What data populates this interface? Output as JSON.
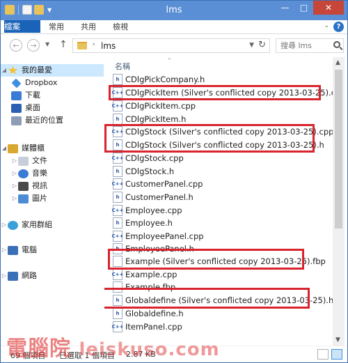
{
  "window": {
    "title": "lms"
  },
  "ribbon": {
    "tabs": [
      "檔案",
      "常用",
      "共用",
      "檢視"
    ],
    "help": "?"
  },
  "address": {
    "path": "lms"
  },
  "search": {
    "placeholder": "搜尋 lms"
  },
  "navpane": {
    "items": [
      {
        "label": "我的最愛",
        "icon": "star-icon",
        "color": "#f2c230"
      },
      {
        "label": "Dropbox",
        "icon": "dropbox-icon",
        "color": "#3d8fe0"
      },
      {
        "label": "下載",
        "icon": "downloads-icon",
        "color": "#3a7bd5"
      },
      {
        "label": "桌面",
        "icon": "desktop-icon",
        "color": "#2b61b3"
      },
      {
        "label": "最近的位置",
        "icon": "recent-places-icon",
        "color": "#8c9db5"
      },
      {
        "label": "媒體櫃",
        "icon": "libraries-icon",
        "color": "#d9a830"
      },
      {
        "label": "文件",
        "icon": "documents-icon",
        "color": "#c7cfdb"
      },
      {
        "label": "音樂",
        "icon": "music-icon",
        "color": "#3a7bd5"
      },
      {
        "label": "視訊",
        "icon": "videos-icon",
        "color": "#4a4a4a"
      },
      {
        "label": "圖片",
        "icon": "pictures-icon",
        "color": "#4c8bd6"
      },
      {
        "label": "家用群組",
        "icon": "homegroup-icon",
        "color": "#3aa0d8"
      },
      {
        "label": "電腦",
        "icon": "computer-icon",
        "color": "#3b6fb6"
      },
      {
        "label": "網路",
        "icon": "network-icon",
        "color": "#3b6fb6"
      }
    ]
  },
  "files": {
    "column_header": "名稱",
    "items": [
      {
        "name": "CDlgPickCompany.h",
        "type": "h"
      },
      {
        "name": "CDlgPickItem (Silver's conflicted copy 2013-03-25).cpp",
        "type": "cpp"
      },
      {
        "name": "CDlgPickItem.cpp",
        "type": "cpp"
      },
      {
        "name": "CDlgPickItem.h",
        "type": "h"
      },
      {
        "name": "CDlgStock (Silver's conflicted copy 2013-03-25).cpp",
        "type": "cpp"
      },
      {
        "name": "CDlgStock (Silver's conflicted copy 2013-03-25).h",
        "type": "h"
      },
      {
        "name": "CDlgStock.cpp",
        "type": "cpp"
      },
      {
        "name": "CDlgStock.h",
        "type": "h"
      },
      {
        "name": "CustomerPanel.cpp",
        "type": "cpp"
      },
      {
        "name": "CustomerPanel.h",
        "type": "h"
      },
      {
        "name": "Employee.cpp",
        "type": "cpp"
      },
      {
        "name": "Employee.h",
        "type": "h"
      },
      {
        "name": "EmployeePanel.cpp",
        "type": "cpp"
      },
      {
        "name": "EmployeePanel.h",
        "type": "h"
      },
      {
        "name": "Example (Silver's conflicted copy 2013-03-25).fbp",
        "type": "fbp"
      },
      {
        "name": "Example.cpp",
        "type": "cpp"
      },
      {
        "name": "Example.fbp",
        "type": "fbp"
      },
      {
        "name": "Globaldefine (Silver's conflicted copy 2013-03-25).h",
        "type": "h"
      },
      {
        "name": "Globaldefine.h",
        "type": "h"
      },
      {
        "name": "ItemPanel.cpp",
        "type": "cpp"
      }
    ]
  },
  "statusbar": {
    "item_count": "69 個項目",
    "selected": "已選取 1 個項目",
    "size": "2.87 KB"
  },
  "watermark": {
    "text_cjk": "電腦院",
    "text_latin": "leiskuso.com"
  },
  "colors": {
    "titlebar": "#5a8fd6",
    "file_tab": "#1b63b8",
    "highlight": "#d9232d"
  }
}
